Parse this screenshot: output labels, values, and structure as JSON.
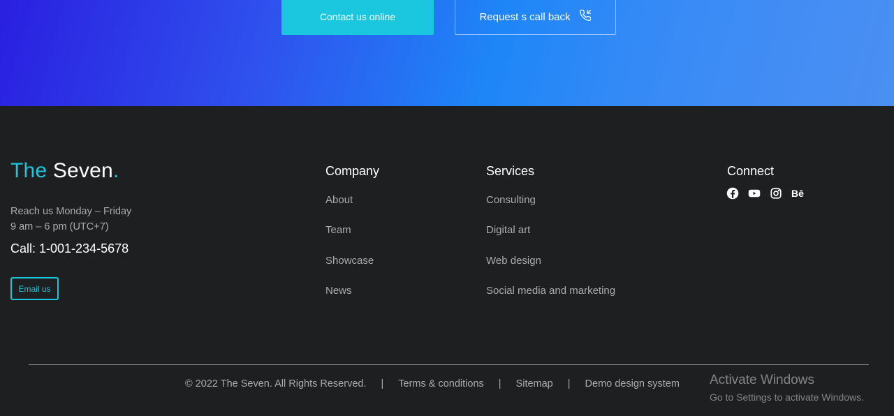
{
  "hero": {
    "contact_label": "Contact us online",
    "callback_label": "Request s call back",
    "callback_icon": "phone-incoming-icon"
  },
  "footer": {
    "brand": {
      "part1": "The",
      "part2": "Seven",
      "dot": "."
    },
    "hours_line1": "Reach us Monday – Friday",
    "hours_line2": "9 am – 6 pm (UTC+7)",
    "phone": "Call: 1-001-234-5678",
    "email_button": "Email us",
    "company": {
      "title": "Company",
      "links": [
        "About",
        "Team",
        "Showcase",
        "News"
      ]
    },
    "services": {
      "title": "Services",
      "links": [
        "Consulting",
        "Digital art",
        "Web design",
        "Social media and marketing"
      ]
    },
    "connect": {
      "title": "Connect",
      "icons": [
        "facebook-icon",
        "youtube-icon",
        "instagram-icon",
        "behance-icon"
      ],
      "behance_text": "Bē"
    },
    "bottom": {
      "copyright": "© 2022 The Seven. All Rights Reserved.",
      "separator": "|",
      "terms": "Terms & conditions",
      "sitemap": "Sitemap",
      "demo": "Demo design system"
    }
  },
  "watermark": {
    "line1": "Activate Windows",
    "line2": "Go to Settings to activate Windows."
  },
  "colors": {
    "accent": "#1bc6df",
    "footer_bg": "#1e1f21",
    "muted_text": "#a9abad"
  }
}
